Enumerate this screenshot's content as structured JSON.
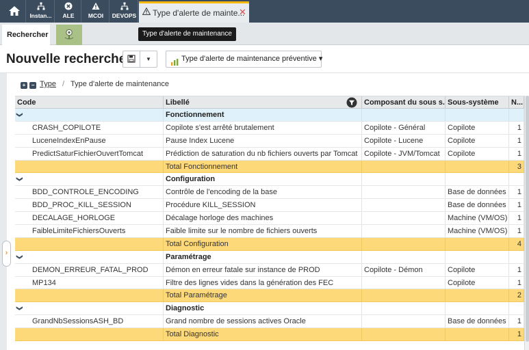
{
  "topbar": {
    "apps": [
      {
        "label": "Instan...",
        "icon": "hierarchy-icon"
      },
      {
        "label": "ALE",
        "icon": "close-circle-icon"
      },
      {
        "label": "MCOI",
        "icon": "warning-icon"
      },
      {
        "label": "DEVOPS",
        "icon": "hierarchy-icon"
      }
    ],
    "doc_tab": {
      "title": "Type d'alerte de mainte...",
      "icon": "warning-icon",
      "close_glyph": "✕"
    }
  },
  "tooltip": "Type d'alerte de maintenance",
  "subtabs": {
    "search_label": "Rechercher",
    "map_icon": "map-pin-icon"
  },
  "toolbar": {
    "title": "Nouvelle recherche",
    "save_icon": "save-icon",
    "view_label": "Type d'alerte de maintenance préventive",
    "view_caret": "▾"
  },
  "breadcrumb": {
    "expand": "+",
    "collapse": "−",
    "link": "Type",
    "separator": "/",
    "current": "Type d'alerte de maintenance"
  },
  "grid": {
    "columns": {
      "code": "Code",
      "libelle": "Libellé",
      "composant": "Composant du sous s...",
      "sous_systeme": "Sous-système",
      "n": "N..."
    },
    "groups": [
      {
        "name": "Fonctionnement",
        "rows": [
          {
            "code": "CRASH_COPILOTE",
            "libelle": "Copilote s'est arrêté brutalement",
            "composant": "Copilote - Général",
            "sous_systeme": "Copilote",
            "n": "1"
          },
          {
            "code": "LuceneIndexEnPause",
            "libelle": "Pause Index Lucene",
            "composant": "Copilote - Lucene",
            "sous_systeme": "Copilote",
            "n": "1"
          },
          {
            "code": "PredictSaturFichierOuvertTomcat",
            "libelle": "Prédiction de saturation du nb fichiers ouverts par Tomcat",
            "composant": "Copilote - JVM/Tomcat",
            "sous_systeme": "Copilote",
            "n": "1"
          }
        ],
        "total_label": "Total Fonctionnement",
        "total_n": "3"
      },
      {
        "name": "Configuration",
        "rows": [
          {
            "code": "BDD_CONTROLE_ENCODING",
            "libelle": "Contrôle de l'encoding de la base",
            "composant": "",
            "sous_systeme": "Base de données",
            "n": "1"
          },
          {
            "code": "BDD_PROC_KILL_SESSION",
            "libelle": "Procédure KILL_SESSION",
            "composant": "",
            "sous_systeme": "Base de données",
            "n": "1"
          },
          {
            "code": "DECALAGE_HORLOGE",
            "libelle": "Décalage horloge des machines",
            "composant": "",
            "sous_systeme": "Machine (VM/OS)",
            "n": "1"
          },
          {
            "code": "FaibleLimiteFichiersOuverts",
            "libelle": "Faible limite sur le nombre de fichiers ouverts",
            "composant": "",
            "sous_systeme": "Machine (VM/OS)",
            "n": "1"
          }
        ],
        "total_label": "Total Configuration",
        "total_n": "4"
      },
      {
        "name": "Paramétrage",
        "rows": [
          {
            "code": "DEMON_ERREUR_FATAL_PROD",
            "libelle": "Démon en erreur fatale sur instance de PROD",
            "composant": "Copilote - Démon",
            "sous_systeme": "Copilote",
            "n": "1"
          },
          {
            "code": "MP134",
            "libelle": "Filtre des lignes vides dans la génération des FEC",
            "composant": "",
            "sous_systeme": "Copilote",
            "n": "1"
          }
        ],
        "total_label": "Total Paramétrage",
        "total_n": "2"
      },
      {
        "name": "Diagnostic",
        "rows": [
          {
            "code": "GrandNbSessionsASH_BD",
            "libelle": "Grand nombre de sessions actives Oracle",
            "composant": "",
            "sous_systeme": "Base de données",
            "n": "1"
          }
        ],
        "total_label": "Total Diagnostic",
        "total_n": "1"
      }
    ]
  },
  "colors": {
    "topbar": "#3c4c5f",
    "tab_accent": "#f5b700",
    "group_row": "#dff1fb",
    "total_row": "#fdd97a",
    "close": "#e04b4b"
  }
}
